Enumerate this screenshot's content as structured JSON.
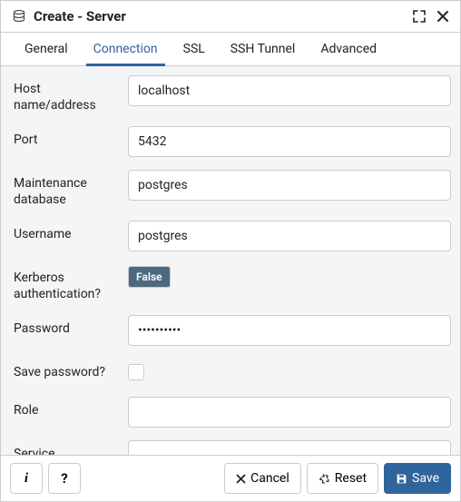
{
  "dialog": {
    "title": "Create - Server"
  },
  "tabs": [
    {
      "label": "General"
    },
    {
      "label": "Connection"
    },
    {
      "label": "SSL"
    },
    {
      "label": "SSH Tunnel"
    },
    {
      "label": "Advanced"
    }
  ],
  "form": {
    "host": {
      "label": "Host name/address",
      "value": "localhost"
    },
    "port": {
      "label": "Port",
      "value": "5432"
    },
    "maintenance_db": {
      "label": "Maintenance database",
      "value": "postgres"
    },
    "username": {
      "label": "Username",
      "value": "postgres"
    },
    "kerberos": {
      "label": "Kerberos authentication?",
      "value": "False"
    },
    "password": {
      "label": "Password",
      "value": "••••••••••"
    },
    "save_password": {
      "label": "Save password?",
      "checked": false
    },
    "role": {
      "label": "Role",
      "value": ""
    },
    "service": {
      "label": "Service",
      "value": ""
    }
  },
  "footer": {
    "info": "i",
    "help": "?",
    "cancel": "Cancel",
    "reset": "Reset",
    "save": "Save"
  }
}
